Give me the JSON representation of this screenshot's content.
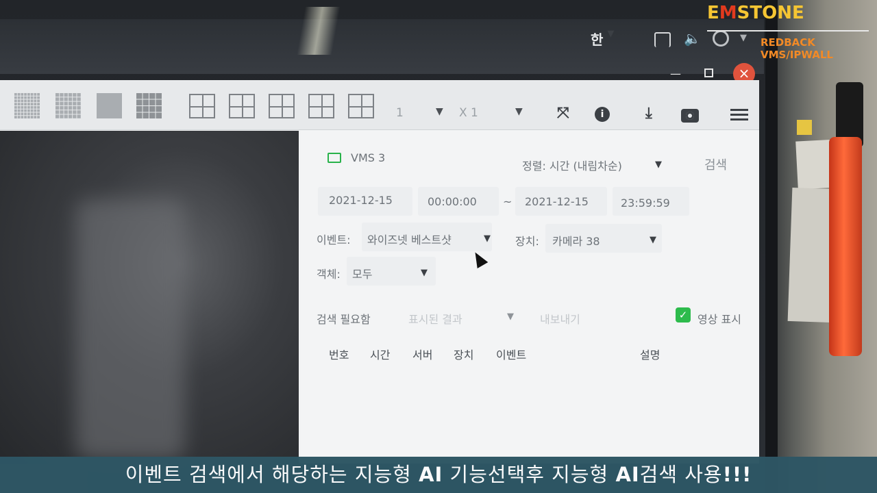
{
  "brand": {
    "name_e": "E",
    "name_m": "M",
    "name_rest": "STONE",
    "subtitle": "REDBACK VMS/IPWALL"
  },
  "os_bar": {
    "language": "한"
  },
  "toolbar": {
    "page_value": "1",
    "zoom_value": "X 1"
  },
  "panel": {
    "server_name": "VMS 3",
    "sort_label": "정렬: 시간 (내림차순)",
    "search_button": "검색",
    "start_date": "2021-12-15",
    "start_time": "00:00:00",
    "range_sep": "~",
    "end_date": "2021-12-15",
    "end_time": "23:59:59",
    "event_label": "이벤트:",
    "event_value": "와이즈넷 베스트샷",
    "device_label": "장치:",
    "device_value": "카메라 38",
    "object_label": "객체:",
    "object_value": "모두",
    "search_needed": "검색 필요함",
    "display_result": "표시된 결과",
    "export_label": "내보내기",
    "show_video_label": "영상 표시",
    "columns": [
      "번호",
      "시간",
      "서버",
      "장치",
      "이벤트",
      "설명"
    ]
  },
  "caption": {
    "part1": "이벤트 검색에서 해당하는 지능형 ",
    "ai1": "AI",
    "part2": " 기능선택후 지능형 ",
    "ai2": "AI",
    "part3": "검색 사용",
    "exclaim": "!!!"
  },
  "colors": {
    "brand_yellow": "#f5c533",
    "brand_red": "#e23a1e",
    "checkbox_green": "#2dbb4c",
    "close_red": "#e0533d",
    "caption_bg": "#2e5664"
  }
}
